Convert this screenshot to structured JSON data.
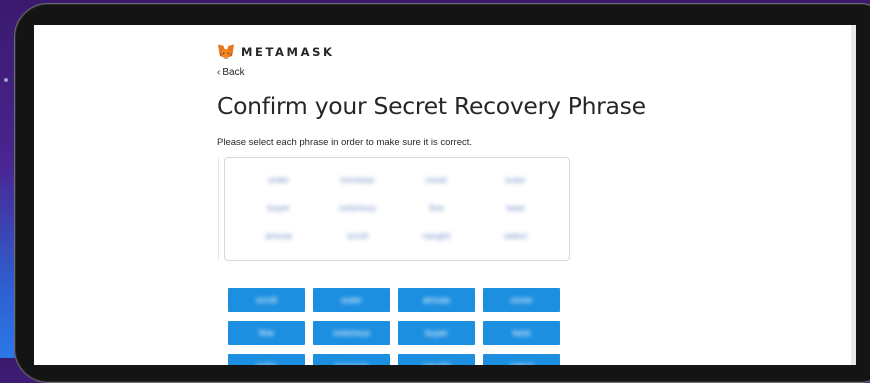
{
  "brand": {
    "name": "METAMASK",
    "logo_icon": "metamask-fox-icon"
  },
  "nav": {
    "back_label": "Back",
    "back_icon": "chevron-left-icon"
  },
  "heading": {
    "title": "Confirm your Secret Recovery Phrase",
    "subtitle": "Please select each phrase in order to make sure it is correct."
  },
  "selected_words": [
    "order",
    "increase",
    "cover",
    "outer",
    "buyer",
    "notorious",
    "fine",
    "twist",
    "amuse",
    "scroll",
    "naught",
    "select"
  ],
  "word_buttons": [
    "scroll",
    "outer",
    "amuse",
    "cover",
    "fine",
    "notorious",
    "buyer",
    "twist",
    "order",
    "increase",
    "naught",
    "select"
  ],
  "colors": {
    "button_blue": "#1d8fe0",
    "text_dark": "#24272a",
    "frame": "#141414"
  }
}
